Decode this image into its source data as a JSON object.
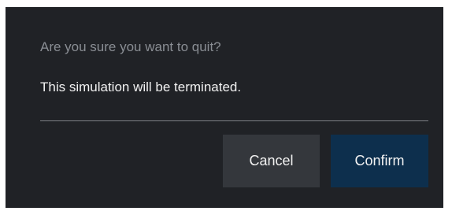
{
  "dialog": {
    "title": "Are you sure you want to quit?",
    "message": "This simulation will be terminated.",
    "cancel_label": "Cancel",
    "confirm_label": "Confirm"
  },
  "colors": {
    "dialog_background": "#202226",
    "title_text": "#8a8e94",
    "message_text": "#f2f2f2",
    "divider": "#7e8186",
    "cancel_button": "#34373c",
    "confirm_button": "#0d2f4d"
  }
}
